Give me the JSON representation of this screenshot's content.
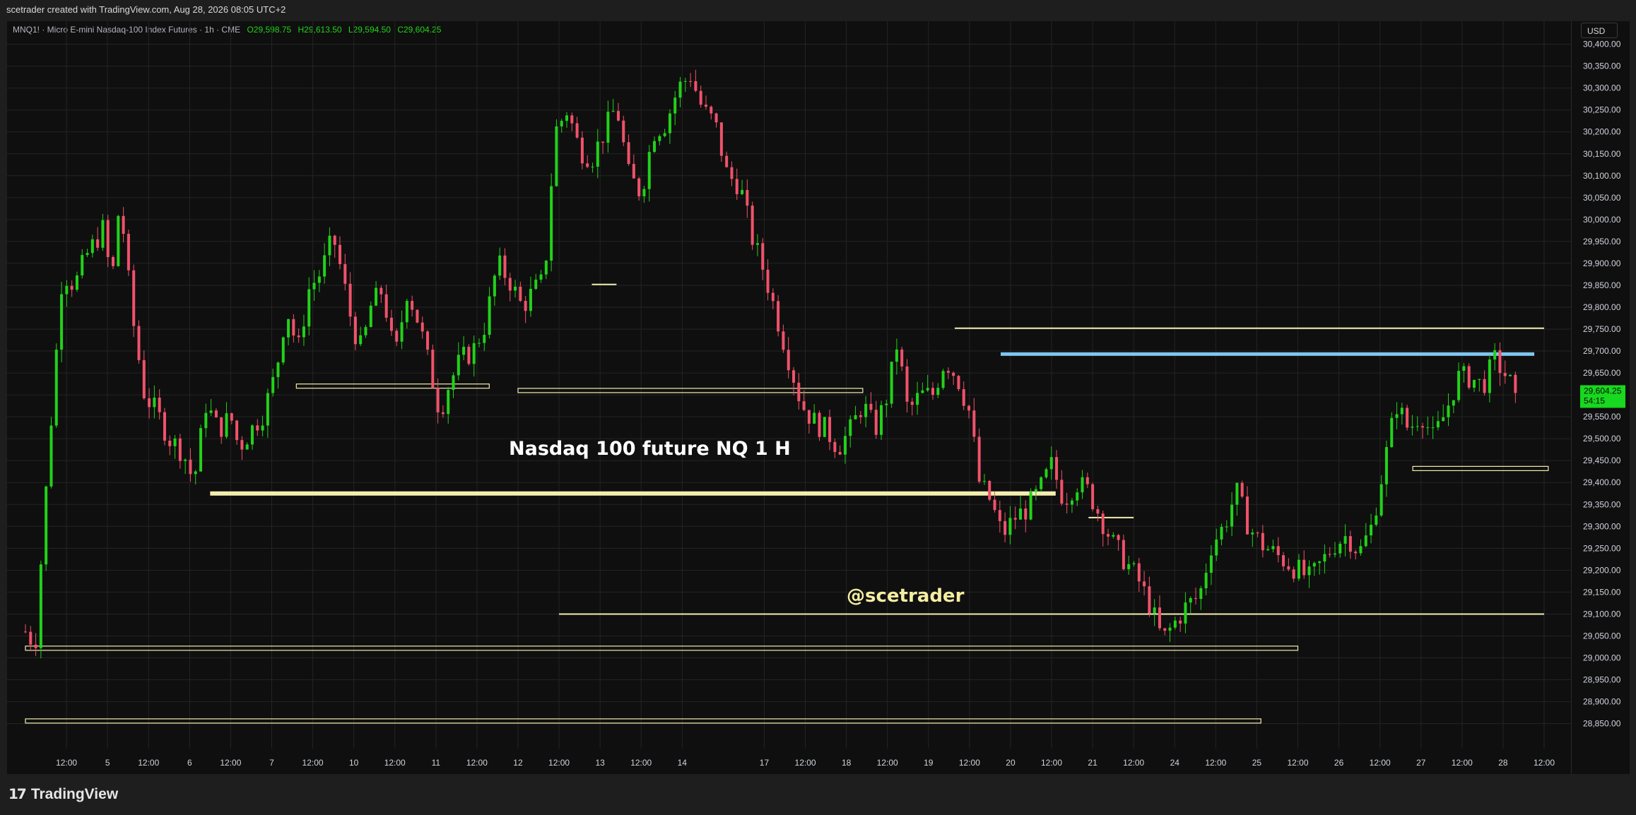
{
  "header": {
    "title": "scetrader created with TradingView.com, Aug 28, 2026 08:05 UTC+2"
  },
  "legend": {
    "symbol": "MNQ1! · Micro E-mini Nasdaq-100 Index Futures · 1h · CME",
    "open": "O29,598.75",
    "high": "H29,613.50",
    "low": "L29,594.50",
    "close": "C29,604.25"
  },
  "currency_button": "USD",
  "brand": "TradingView",
  "colors": {
    "up": "#22d11a",
    "down": "#f0526a",
    "level": "#f2eeb0",
    "resistance": "#7fc6ef",
    "price_tag": "#18d81f"
  },
  "chart_data": {
    "type": "candlestick",
    "title": "Nasdaq 100 future NQ 1 H",
    "watermark_text": "@scetrader",
    "ylim": [
      28820,
      30460
    ],
    "y_ticks": [
      28850,
      28900,
      28950,
      29000,
      29050,
      29100,
      29150,
      29200,
      29250,
      29300,
      29350,
      29400,
      29450,
      29500,
      29550,
      29600,
      29650,
      29700,
      29750,
      29800,
      29850,
      29900,
      29950,
      30000,
      30050,
      30100,
      30150,
      30200,
      30250,
      30300,
      30350,
      30400
    ],
    "y_tick_labels": [
      "28,850.00",
      "28,900.00",
      "28,950.00",
      "29,000.00",
      "29,050.00",
      "29,100.00",
      "29,150.00",
      "29,200.00",
      "29,250.00",
      "29,300.00",
      "29,350.00",
      "29,400.00",
      "29,450.00",
      "29,500.00",
      "29,550.00",
      "29,600.00",
      "29,650.00",
      "29,700.00",
      "29,750.00",
      "29,800.00",
      "29,850.00",
      "29,900.00",
      "29,950.00",
      "30,000.00",
      "30,050.00",
      "30,100.00",
      "30,150.00",
      "30,200.00",
      "30,250.00",
      "30,300.00",
      "30,350.00",
      "30,400.00"
    ],
    "x_ticks": [
      {
        "label": "12:00",
        "t": 0.5
      },
      {
        "label": "5",
        "t": 1.0
      },
      {
        "label": "12:00",
        "t": 1.5
      },
      {
        "label": "6",
        "t": 2.0
      },
      {
        "label": "12:00",
        "t": 2.5
      },
      {
        "label": "7",
        "t": 3.0
      },
      {
        "label": "12:00",
        "t": 3.5
      },
      {
        "label": "10",
        "t": 4.0
      },
      {
        "label": "12:00",
        "t": 4.5
      },
      {
        "label": "11",
        "t": 5.0
      },
      {
        "label": "12:00",
        "t": 5.5
      },
      {
        "label": "12",
        "t": 6.0
      },
      {
        "label": "12:00",
        "t": 6.5
      },
      {
        "label": "13",
        "t": 7.0
      },
      {
        "label": "12:00",
        "t": 7.5
      },
      {
        "label": "14",
        "t": 8.0
      },
      {
        "label": "17",
        "t": 9.0
      },
      {
        "label": "12:00",
        "t": 9.5
      },
      {
        "label": "18",
        "t": 10.0
      },
      {
        "label": "12:00",
        "t": 10.5
      },
      {
        "label": "19",
        "t": 11.0
      },
      {
        "label": "12:00",
        "t": 11.5
      },
      {
        "label": "20",
        "t": 12.0
      },
      {
        "label": "12:00",
        "t": 12.5
      },
      {
        "label": "21",
        "t": 13.0
      },
      {
        "label": "12:00",
        "t": 13.5
      },
      {
        "label": "24",
        "t": 14.0
      },
      {
        "label": "12:00",
        "t": 14.5
      },
      {
        "label": "25",
        "t": 15.0
      },
      {
        "label": "12:00",
        "t": 15.5
      },
      {
        "label": "26",
        "t": 16.0
      },
      {
        "label": "12:00",
        "t": 16.5
      },
      {
        "label": "27",
        "t": 17.0
      },
      {
        "label": "12:00",
        "t": 17.5
      },
      {
        "label": "28",
        "t": 18.0
      },
      {
        "label": "12:00",
        "t": 18.5
      }
    ],
    "x_range": [
      0.0,
      18.5
    ],
    "last_price": {
      "label": "29,604.25",
      "countdown": "54:15",
      "value": 29604.25
    },
    "price_path": [
      [
        0.0,
        29060
      ],
      [
        0.12,
        29030
      ],
      [
        0.2,
        29250
      ],
      [
        0.32,
        29560
      ],
      [
        0.45,
        29880
      ],
      [
        0.6,
        29850
      ],
      [
        0.75,
        29920
      ],
      [
        0.95,
        29980
      ],
      [
        1.05,
        29850
      ],
      [
        1.15,
        30050
      ],
      [
        1.3,
        29780
      ],
      [
        1.45,
        29600
      ],
      [
        1.6,
        29560
      ],
      [
        1.75,
        29500
      ],
      [
        1.92,
        29470
      ],
      [
        2.05,
        29400
      ],
      [
        2.2,
        29580
      ],
      [
        2.35,
        29520
      ],
      [
        2.5,
        29550
      ],
      [
        2.6,
        29480
      ],
      [
        2.75,
        29520
      ],
      [
        2.9,
        29560
      ],
      [
        3.05,
        29650
      ],
      [
        3.18,
        29800
      ],
      [
        3.32,
        29700
      ],
      [
        3.45,
        29840
      ],
      [
        3.6,
        29880
      ],
      [
        3.75,
        29960
      ],
      [
        3.85,
        29880
      ],
      [
        3.98,
        29760
      ],
      [
        4.1,
        29700
      ],
      [
        4.2,
        29800
      ],
      [
        4.35,
        29840
      ],
      [
        4.5,
        29680
      ],
      [
        4.65,
        29840
      ],
      [
        4.8,
        29760
      ],
      [
        4.95,
        29640
      ],
      [
        5.05,
        29560
      ],
      [
        5.15,
        29620
      ],
      [
        5.3,
        29680
      ],
      [
        5.45,
        29700
      ],
      [
        5.6,
        29760
      ],
      [
        5.75,
        29900
      ],
      [
        5.9,
        29860
      ],
      [
        6.05,
        29800
      ],
      [
        6.2,
        29840
      ],
      [
        6.32,
        29860
      ],
      [
        6.45,
        30200
      ],
      [
        6.6,
        30250
      ],
      [
        6.75,
        30160
      ],
      [
        6.9,
        30140
      ],
      [
        7.05,
        30200
      ],
      [
        7.2,
        30260
      ],
      [
        7.35,
        30100
      ],
      [
        7.5,
        30060
      ],
      [
        7.65,
        30200
      ],
      [
        7.8,
        30220
      ],
      [
        7.95,
        30300
      ],
      [
        8.1,
        30330
      ],
      [
        8.25,
        30250
      ],
      [
        8.4,
        30220
      ],
      [
        8.55,
        30100
      ],
      [
        8.7,
        30080
      ],
      [
        8.85,
        29960
      ],
      [
        9.0,
        29880
      ],
      [
        9.15,
        29780
      ],
      [
        9.3,
        29680
      ],
      [
        9.45,
        29580
      ],
      [
        9.6,
        29540
      ],
      [
        9.75,
        29520
      ],
      [
        9.9,
        29480
      ],
      [
        10.05,
        29520
      ],
      [
        10.2,
        29580
      ],
      [
        10.35,
        29520
      ],
      [
        10.5,
        29600
      ],
      [
        10.62,
        29720
      ],
      [
        10.75,
        29560
      ],
      [
        10.9,
        29600
      ],
      [
        11.05,
        29600
      ],
      [
        11.2,
        29680
      ],
      [
        11.35,
        29640
      ],
      [
        11.5,
        29560
      ],
      [
        11.62,
        29400
      ],
      [
        11.75,
        29360
      ],
      [
        11.9,
        29280
      ],
      [
        12.05,
        29320
      ],
      [
        12.2,
        29340
      ],
      [
        12.35,
        29380
      ],
      [
        12.5,
        29440
      ],
      [
        12.65,
        29360
      ],
      [
        12.8,
        29400
      ],
      [
        12.95,
        29380
      ],
      [
        13.1,
        29320
      ],
      [
        13.25,
        29260
      ],
      [
        13.4,
        29220
      ],
      [
        13.55,
        29180
      ],
      [
        13.7,
        29120
      ],
      [
        13.85,
        29040
      ],
      [
        14.0,
        29080
      ],
      [
        14.15,
        29120
      ],
      [
        14.3,
        29140
      ],
      [
        14.45,
        29260
      ],
      [
        14.6,
        29300
      ],
      [
        14.75,
        29380
      ],
      [
        14.9,
        29300
      ],
      [
        15.05,
        29260
      ],
      [
        15.2,
        29240
      ],
      [
        15.35,
        29220
      ],
      [
        15.5,
        29200
      ],
      [
        15.65,
        29180
      ],
      [
        15.8,
        29220
      ],
      [
        15.95,
        29260
      ],
      [
        16.1,
        29280
      ],
      [
        16.25,
        29240
      ],
      [
        16.4,
        29300
      ],
      [
        16.55,
        29440
      ],
      [
        16.7,
        29580
      ],
      [
        16.85,
        29520
      ],
      [
        17.0,
        29560
      ],
      [
        17.15,
        29500
      ],
      [
        17.3,
        29560
      ],
      [
        17.45,
        29640
      ],
      [
        17.6,
        29640
      ],
      [
        17.75,
        29620
      ],
      [
        17.9,
        29680
      ],
      [
        18.05,
        29640
      ],
      [
        18.15,
        29604
      ]
    ],
    "candle_count": 290,
    "levels": [
      {
        "t0": 3.3,
        "t1": 5.65,
        "y": 29620,
        "style": "band"
      },
      {
        "t0": 6.0,
        "t1": 10.2,
        "y": 29610,
        "style": "band"
      },
      {
        "t0": 2.25,
        "t1": 12.55,
        "y": 29375,
        "style": "thick"
      },
      {
        "t0": 11.32,
        "t1": 18.5,
        "y": 29752,
        "style": "thin"
      },
      {
        "t0": 11.88,
        "t1": 18.38,
        "y": 29693,
        "style": "resistance"
      },
      {
        "t0": 6.5,
        "t1": 18.5,
        "y": 29100,
        "style": "thin"
      },
      {
        "t0": 0.0,
        "t1": 15.5,
        "y": 29022,
        "style": "band"
      },
      {
        "t0": 0.0,
        "t1": 15.05,
        "y": 28856,
        "style": "band"
      },
      {
        "t0": 16.9,
        "t1": 18.55,
        "y": 29432,
        "style": "band"
      },
      {
        "t0": 12.95,
        "t1": 13.5,
        "y": 29320,
        "style": "thin"
      },
      {
        "t0": 6.9,
        "t1": 7.2,
        "y": 29852,
        "style": "thin"
      }
    ]
  }
}
